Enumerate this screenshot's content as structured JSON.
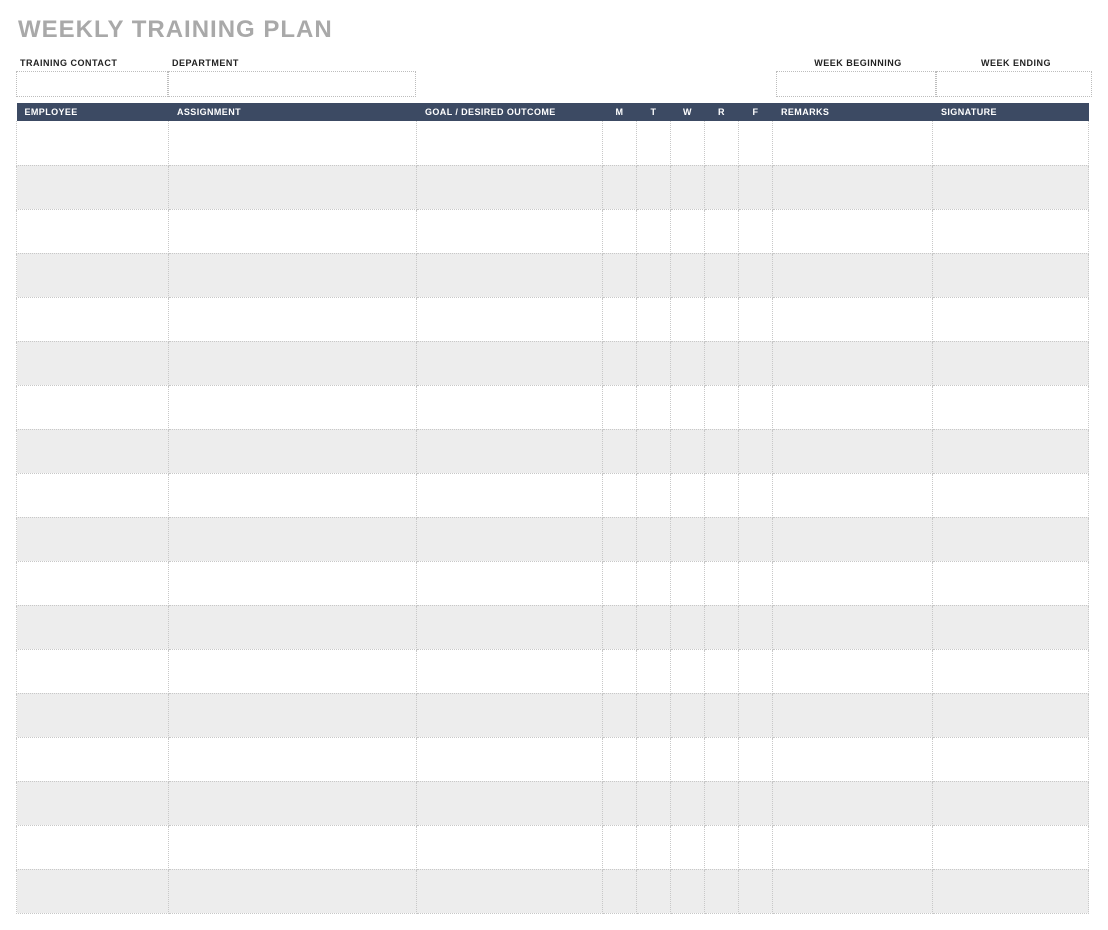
{
  "title": "WEEKLY TRAINING PLAN",
  "meta": {
    "training_contact_label": "TRAINING CONTACT",
    "training_contact_value": "",
    "department_label": "DEPARTMENT",
    "department_value": "",
    "week_beginning_label": "WEEK BEGINNING",
    "week_beginning_value": "",
    "week_ending_label": "WEEK ENDING",
    "week_ending_value": ""
  },
  "columns": {
    "employee": "EMPLOYEE",
    "assignment": "ASSIGNMENT",
    "goal": "GOAL / DESIRED OUTCOME",
    "m": "M",
    "t": "T",
    "w": "W",
    "r": "R",
    "f": "F",
    "remarks": "REMARKS",
    "signature": "SIGNATURE"
  },
  "rows": [
    {
      "employee": "",
      "assignment": "",
      "goal": "",
      "m": "",
      "t": "",
      "w": "",
      "r": "",
      "f": "",
      "remarks": "",
      "signature": ""
    },
    {
      "employee": "",
      "assignment": "",
      "goal": "",
      "m": "",
      "t": "",
      "w": "",
      "r": "",
      "f": "",
      "remarks": "",
      "signature": ""
    },
    {
      "employee": "",
      "assignment": "",
      "goal": "",
      "m": "",
      "t": "",
      "w": "",
      "r": "",
      "f": "",
      "remarks": "",
      "signature": ""
    },
    {
      "employee": "",
      "assignment": "",
      "goal": "",
      "m": "",
      "t": "",
      "w": "",
      "r": "",
      "f": "",
      "remarks": "",
      "signature": ""
    },
    {
      "employee": "",
      "assignment": "",
      "goal": "",
      "m": "",
      "t": "",
      "w": "",
      "r": "",
      "f": "",
      "remarks": "",
      "signature": ""
    },
    {
      "employee": "",
      "assignment": "",
      "goal": "",
      "m": "",
      "t": "",
      "w": "",
      "r": "",
      "f": "",
      "remarks": "",
      "signature": ""
    },
    {
      "employee": "",
      "assignment": "",
      "goal": "",
      "m": "",
      "t": "",
      "w": "",
      "r": "",
      "f": "",
      "remarks": "",
      "signature": ""
    },
    {
      "employee": "",
      "assignment": "",
      "goal": "",
      "m": "",
      "t": "",
      "w": "",
      "r": "",
      "f": "",
      "remarks": "",
      "signature": ""
    },
    {
      "employee": "",
      "assignment": "",
      "goal": "",
      "m": "",
      "t": "",
      "w": "",
      "r": "",
      "f": "",
      "remarks": "",
      "signature": ""
    },
    {
      "employee": "",
      "assignment": "",
      "goal": "",
      "m": "",
      "t": "",
      "w": "",
      "r": "",
      "f": "",
      "remarks": "",
      "signature": ""
    },
    {
      "employee": "",
      "assignment": "",
      "goal": "",
      "m": "",
      "t": "",
      "w": "",
      "r": "",
      "f": "",
      "remarks": "",
      "signature": ""
    },
    {
      "employee": "",
      "assignment": "",
      "goal": "",
      "m": "",
      "t": "",
      "w": "",
      "r": "",
      "f": "",
      "remarks": "",
      "signature": ""
    },
    {
      "employee": "",
      "assignment": "",
      "goal": "",
      "m": "",
      "t": "",
      "w": "",
      "r": "",
      "f": "",
      "remarks": "",
      "signature": ""
    },
    {
      "employee": "",
      "assignment": "",
      "goal": "",
      "m": "",
      "t": "",
      "w": "",
      "r": "",
      "f": "",
      "remarks": "",
      "signature": ""
    },
    {
      "employee": "",
      "assignment": "",
      "goal": "",
      "m": "",
      "t": "",
      "w": "",
      "r": "",
      "f": "",
      "remarks": "",
      "signature": ""
    },
    {
      "employee": "",
      "assignment": "",
      "goal": "",
      "m": "",
      "t": "",
      "w": "",
      "r": "",
      "f": "",
      "remarks": "",
      "signature": ""
    },
    {
      "employee": "",
      "assignment": "",
      "goal": "",
      "m": "",
      "t": "",
      "w": "",
      "r": "",
      "f": "",
      "remarks": "",
      "signature": ""
    },
    {
      "employee": "",
      "assignment": "",
      "goal": "",
      "m": "",
      "t": "",
      "w": "",
      "r": "",
      "f": "",
      "remarks": "",
      "signature": ""
    }
  ]
}
